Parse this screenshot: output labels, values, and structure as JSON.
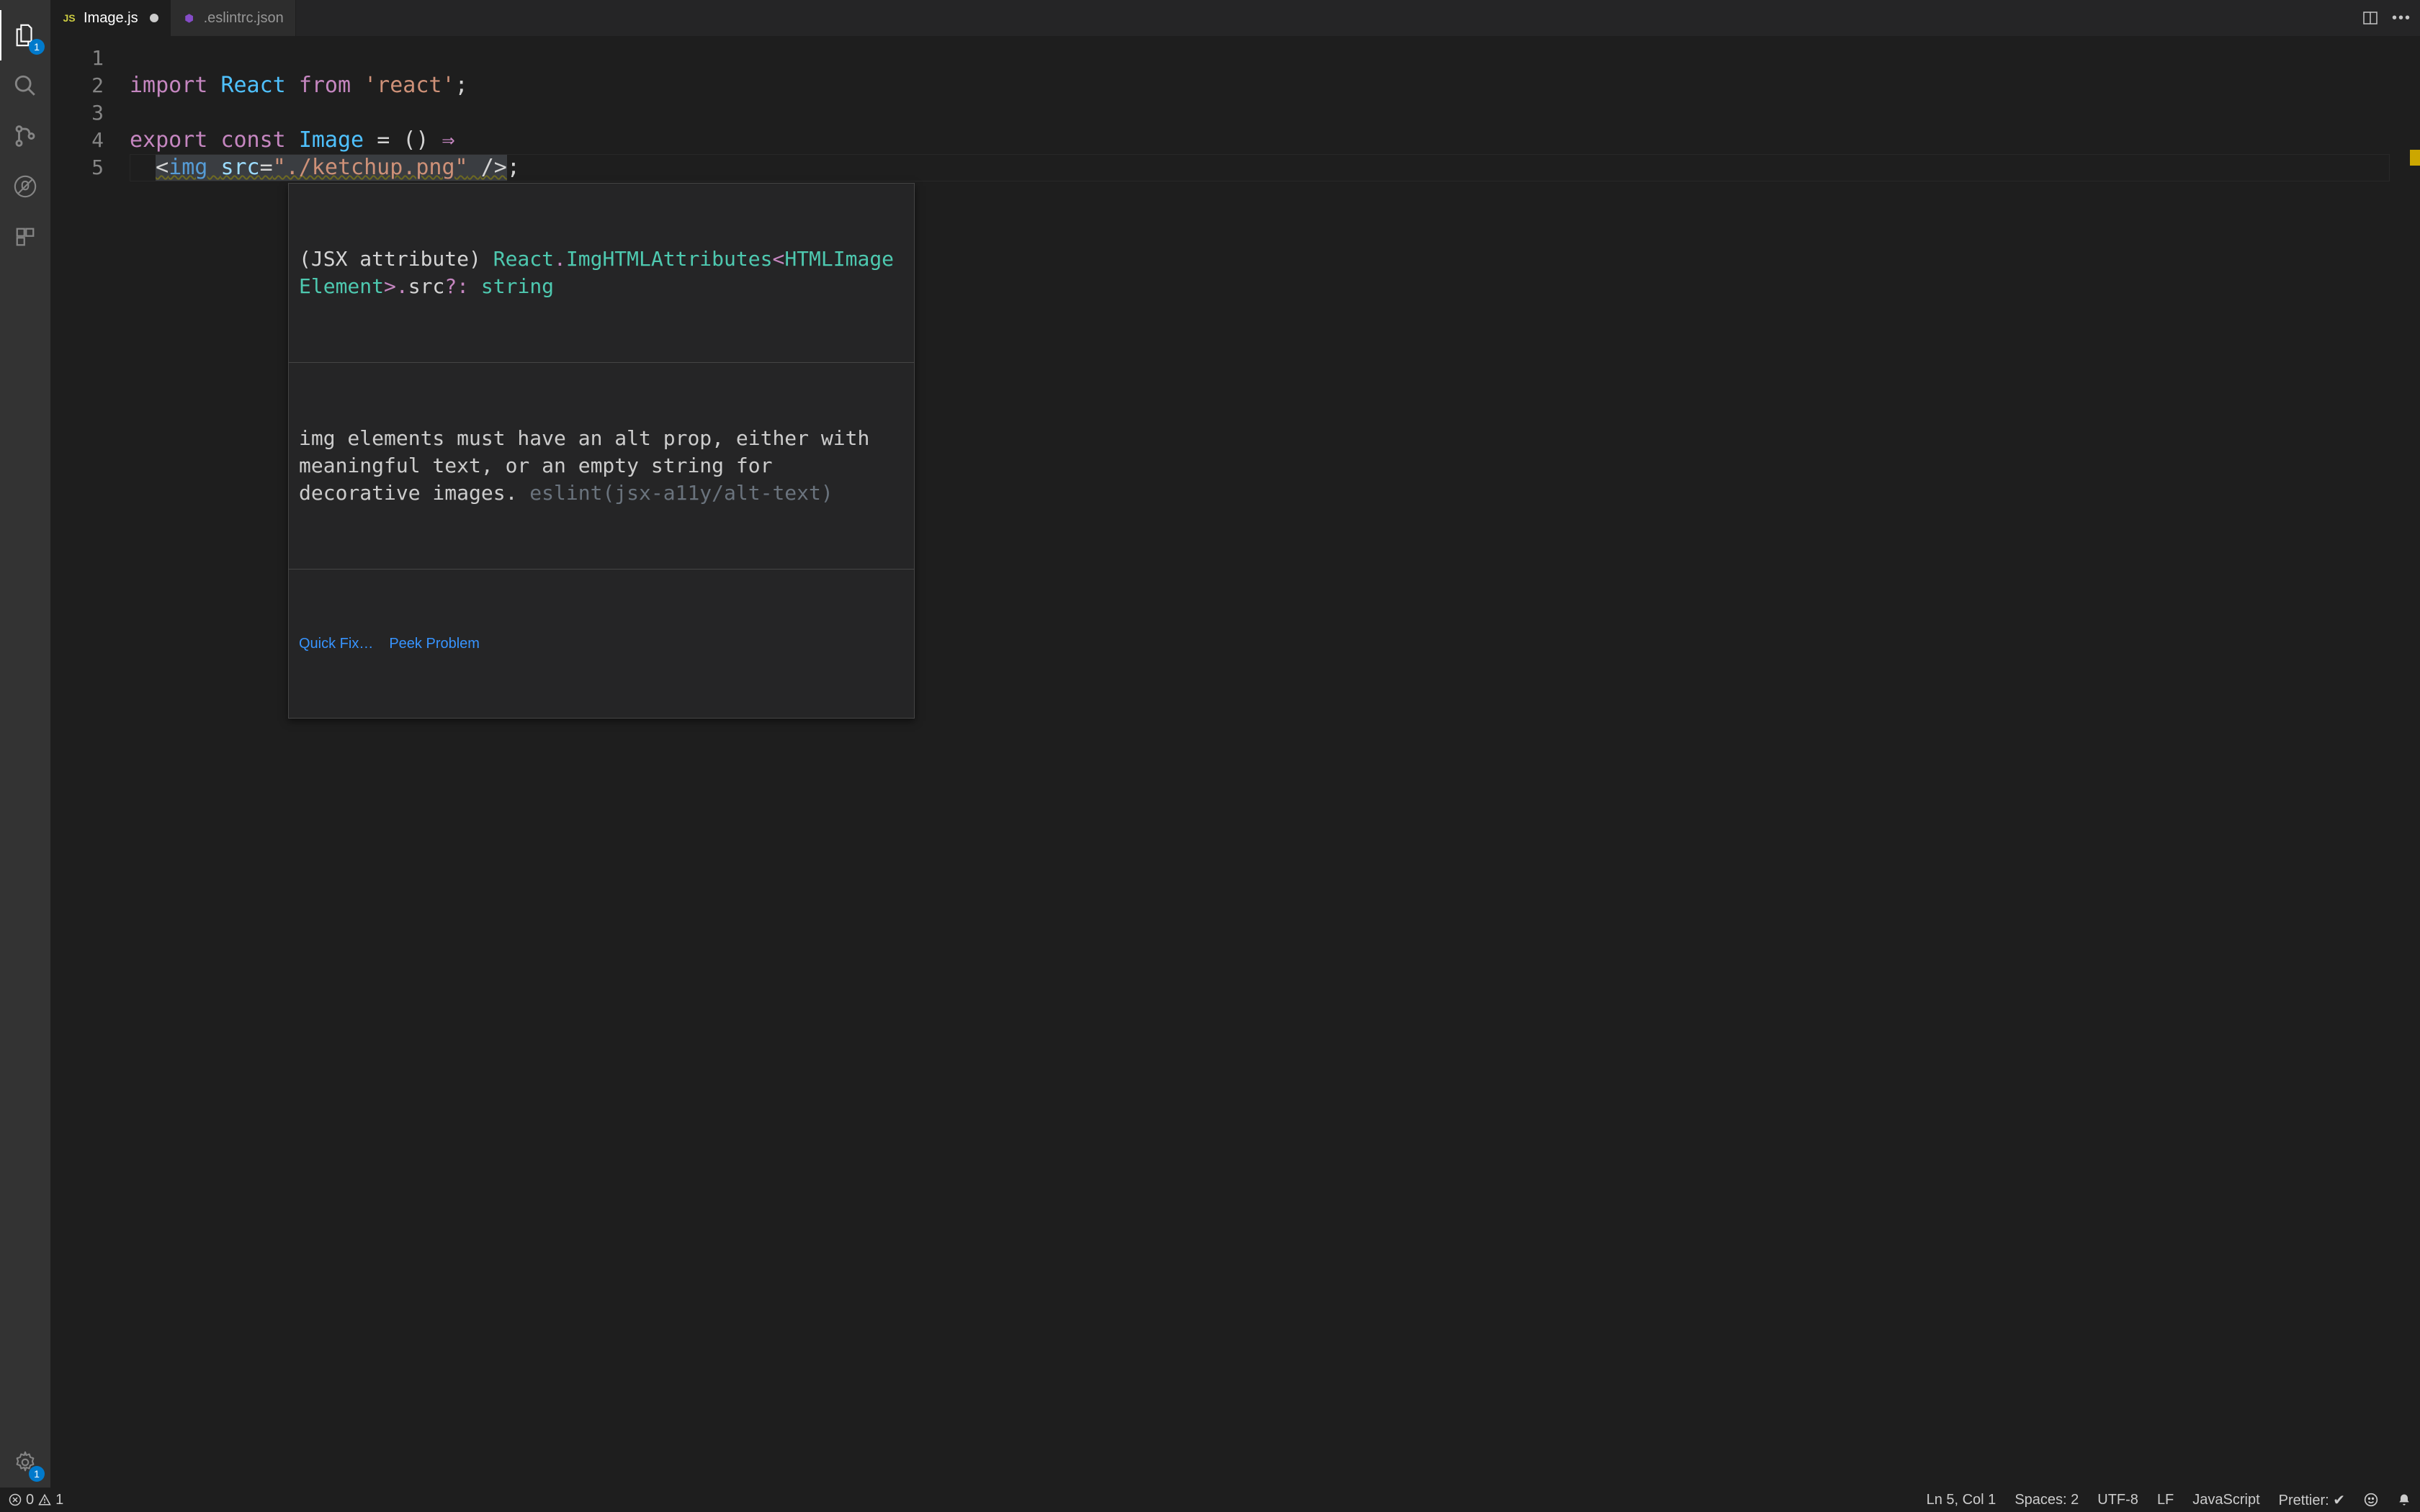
{
  "tabs": [
    {
      "icon": "JS",
      "label": "Image.js",
      "active": true,
      "dirty": true
    },
    {
      "icon": "⬢",
      "label": ".eslintrc.json",
      "active": false,
      "dirty": false
    }
  ],
  "activity_badges": {
    "explorer": "1",
    "settings": "1"
  },
  "gutter": [
    "1",
    "2",
    "3",
    "4",
    "5"
  ],
  "code": {
    "l1": {
      "kw1": "import",
      "var": "React",
      "kw2": "from",
      "str": "'react'",
      "semi": ";"
    },
    "l3": {
      "kw1": "export",
      "kw2": "const",
      "name": "Image",
      "eq": "=",
      "paren": "()",
      "arrow": "⇒"
    },
    "l4": {
      "open": "<",
      "tag": "img",
      "attr": "src",
      "eq": "=",
      "str": "\"./ketchup.png\"",
      "close": "/>",
      "semi": ";"
    }
  },
  "hover": {
    "type_prefix": "(JSX attribute) ",
    "type_ns": "React",
    "type_dot1": ".",
    "type_cls": "ImgHTMLAttributes",
    "type_lt": "<",
    "type_arg": "HTMLImageElement",
    "type_gt": ">",
    "type_dot2": ".",
    "type_prop": "src",
    "type_opt": "?:",
    "type_ret": " string",
    "message": "img elements must have an alt prop, either with meaningful text, or an empty string for decorative images.",
    "rule": "eslint(jsx-a11y/alt-text)",
    "quick_fix": "Quick Fix…",
    "peek": "Peek Problem"
  },
  "status": {
    "errors": "0",
    "warnings": "1",
    "ln_col": "Ln 5, Col 1",
    "spaces": "Spaces: 2",
    "encoding": "UTF-8",
    "eol": "LF",
    "language": "JavaScript",
    "prettier": "Prettier: ✔"
  },
  "colors": {
    "warning_ruler": "#cca700"
  }
}
